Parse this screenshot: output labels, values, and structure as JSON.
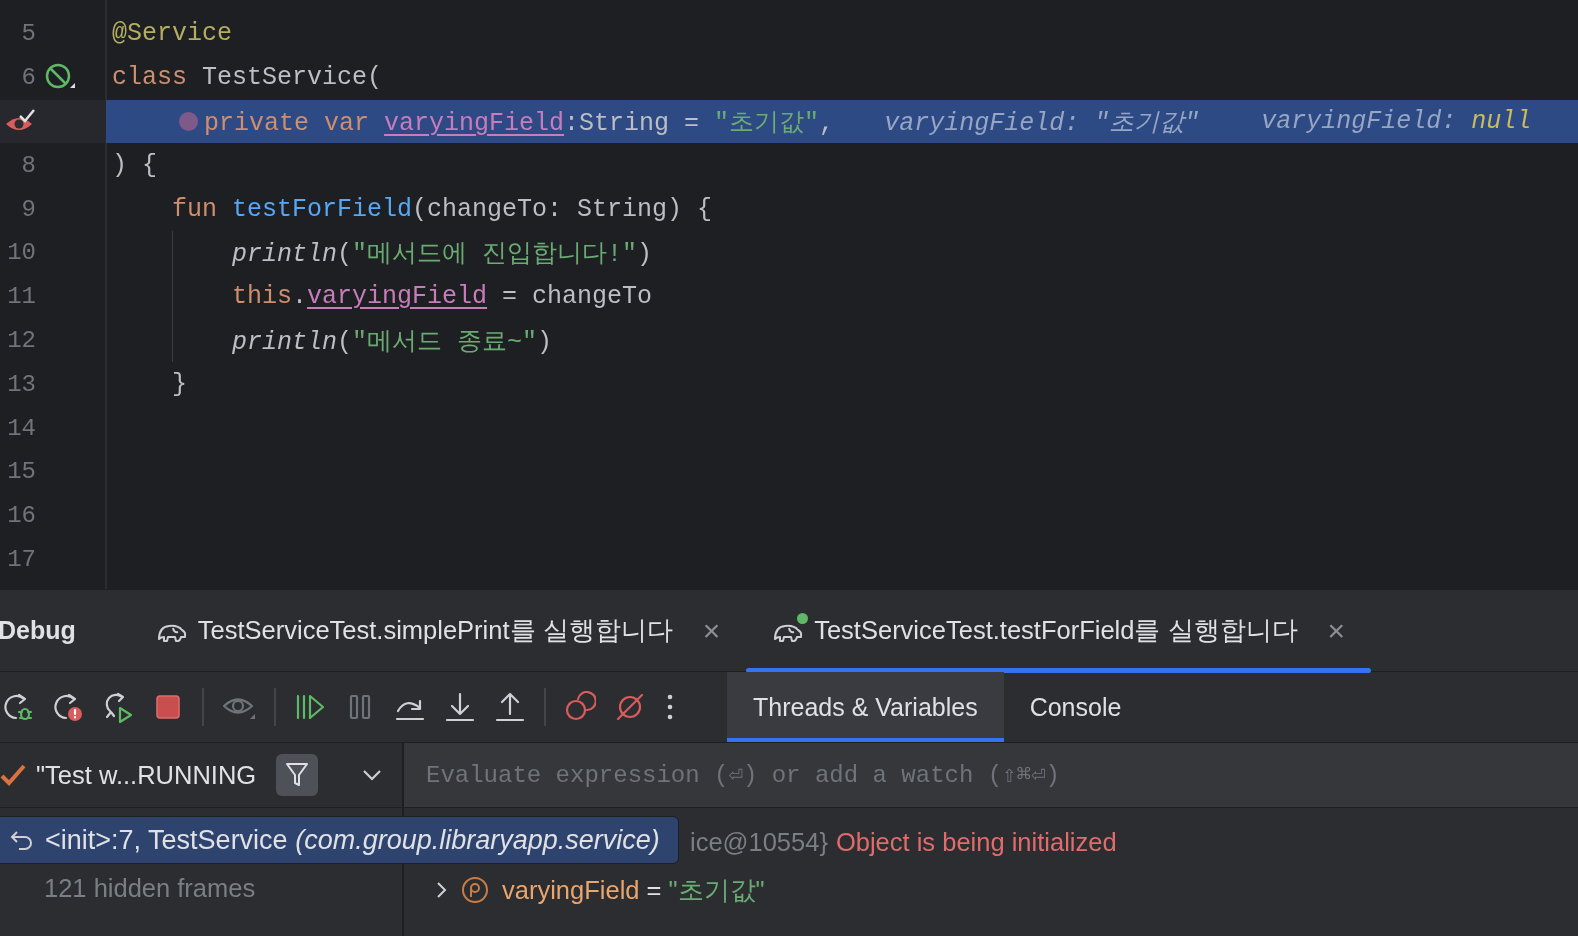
{
  "editor": {
    "lines": [
      {
        "number": "5",
        "kind": "plain",
        "current": false,
        "guide": false,
        "tokens": [
          {
            "kind": "annotation",
            "text": "@Service"
          }
        ]
      },
      {
        "number": "6",
        "kind": "disabled-breakpoint",
        "current": false,
        "guide": false,
        "tokens": [
          {
            "kind": "keyword",
            "text": "class "
          },
          {
            "kind": "plain",
            "text": "TestService("
          }
        ]
      },
      {
        "kind": "current-breakpoint",
        "current": true,
        "guide": false,
        "tokens": [
          {
            "kind": "dot"
          },
          {
            "kind": "keyword",
            "text": "private var "
          },
          {
            "kind": "field",
            "text": "varyingField"
          },
          {
            "kind": "plain",
            "text": ":String = "
          },
          {
            "kind": "string",
            "text": "\"초기값\""
          },
          {
            "kind": "plain",
            "text": ","
          },
          {
            "kind": "hint",
            "text": "varyingField: \"초기값\""
          },
          {
            "kind": "hint",
            "text": "varyingField: ",
            "value": "null"
          }
        ]
      },
      {
        "number": "8",
        "kind": "plain",
        "current": false,
        "guide": false,
        "tokens": [
          {
            "kind": "plain",
            "text": ") {"
          }
        ]
      },
      {
        "number": "9",
        "kind": "plain",
        "current": false,
        "guide": false,
        "tokens": [
          {
            "kind": "keyword",
            "text": "    fun "
          },
          {
            "kind": "function",
            "text": "testForField"
          },
          {
            "kind": "plain",
            "text": "(changeTo: String) {"
          }
        ]
      },
      {
        "number": "10",
        "kind": "plain",
        "current": false,
        "guide": true,
        "tokens": [
          {
            "kind": "call",
            "text": "println"
          },
          {
            "kind": "plain",
            "text": "("
          },
          {
            "kind": "string",
            "text": "\"메서드에 진입합니다!\""
          },
          {
            "kind": "plain",
            "text": ")"
          }
        ]
      },
      {
        "number": "11",
        "kind": "plain",
        "current": false,
        "guide": true,
        "tokens": [
          {
            "kind": "keyword",
            "text": "this"
          },
          {
            "kind": "plain",
            "text": "."
          },
          {
            "kind": "field",
            "text": "varyingField"
          },
          {
            "kind": "plain",
            "text": " = changeTo"
          }
        ]
      },
      {
        "number": "12",
        "kind": "plain",
        "current": false,
        "guide": true,
        "tokens": [
          {
            "kind": "call",
            "text": "println"
          },
          {
            "kind": "plain",
            "text": "("
          },
          {
            "kind": "string",
            "text": "\"메서드 종료~\""
          },
          {
            "kind": "plain",
            "text": ")"
          }
        ]
      },
      {
        "number": "13",
        "kind": "plain",
        "current": false,
        "guide": false,
        "tokens": [
          {
            "kind": "plain",
            "text": "    }"
          }
        ]
      },
      {
        "number": "14",
        "kind": "plain",
        "current": false,
        "guide": false
      },
      {
        "number": "15",
        "kind": "plain",
        "current": false,
        "guide": false
      },
      {
        "number": "16",
        "kind": "plain",
        "current": false,
        "guide": false
      },
      {
        "number": "17",
        "kind": "plain",
        "current": false,
        "guide": false
      }
    ]
  },
  "debug": {
    "title": "Debug",
    "sessions": [
      {
        "label": "TestServiceTest.simplePrint를 실행합니다",
        "selected": false,
        "running": false,
        "close": "×"
      },
      {
        "label": "TestServiceTest.testForField를 실행합니다",
        "selected": true,
        "running": true,
        "close": "×"
      }
    ],
    "toolbar": [
      {
        "kind": "rerun-debug",
        "disabled": false
      },
      {
        "kind": "rerun-failed",
        "disabled": false
      },
      {
        "kind": "rerun-auto",
        "disabled": false
      },
      {
        "kind": "stop",
        "disabled": false
      },
      {
        "kind": "sep"
      },
      {
        "kind": "view",
        "disabled": true
      },
      {
        "kind": "sep"
      },
      {
        "kind": "resume",
        "disabled": false
      },
      {
        "kind": "pause",
        "disabled": true
      },
      {
        "kind": "step-over",
        "disabled": false
      },
      {
        "kind": "step-into",
        "disabled": false
      },
      {
        "kind": "step-out",
        "disabled": false
      },
      {
        "kind": "sep"
      },
      {
        "kind": "breakpoints",
        "disabled": false
      },
      {
        "kind": "mute",
        "disabled": false
      },
      {
        "kind": "more",
        "disabled": false
      }
    ],
    "tabs": [
      {
        "label": "Threads & Variables",
        "selected": true
      },
      {
        "label": "Console",
        "selected": false
      }
    ],
    "thread": {
      "label": "\"Test w...RUNNING",
      "filter_on": true
    },
    "evaluate": {
      "placeholder": "Evaluate expression (⏎) or add a watch (⇧⌘⏎)"
    },
    "frames": [
      {
        "text": "<init>:7, TestService *(com.group.libraryapp.service)*",
        "selected": true
      }
    ],
    "hidden_frames": "121 hidden frames",
    "variables": [
      {
        "kind": "this",
        "text": "ice@10554}",
        "status": "Object is being initialized"
      },
      {
        "kind": "property",
        "name": "varyingField",
        "op": " = ",
        "value": "\"초기값\"",
        "expanded": false
      }
    ]
  }
}
